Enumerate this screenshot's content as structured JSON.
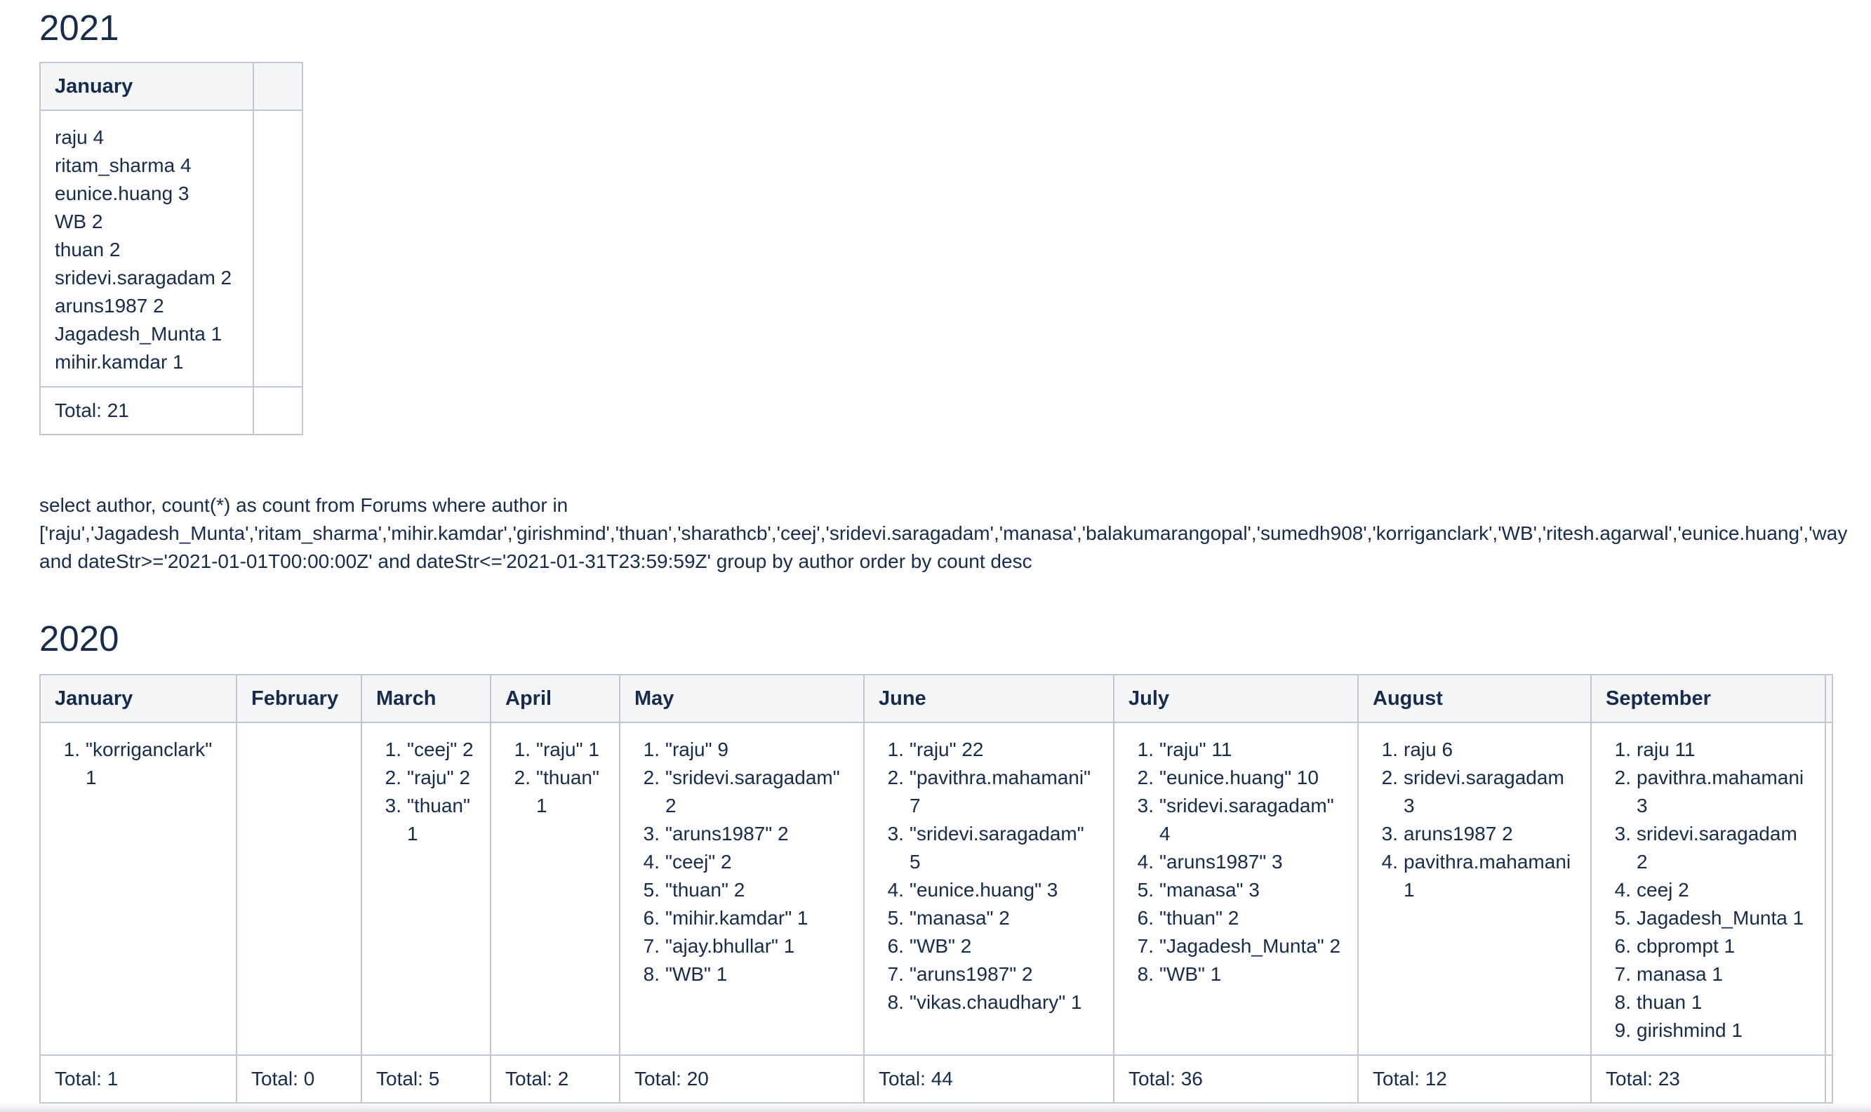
{
  "section_2021": {
    "year": "2021",
    "header": [
      "January",
      ""
    ],
    "entries": [
      "raju 4",
      "ritam_sharma 4",
      "eunice.huang 3",
      "WB 2",
      "thuan 2",
      "sridevi.saragadam 2",
      "aruns1987 2",
      "Jagadesh_Munta 1",
      "mihir.kamdar 1"
    ],
    "total": "Total: 21"
  },
  "query": {
    "line1": "select author, count(*) as count from Forums where author in",
    "line2": "['raju','Jagadesh_Munta','ritam_sharma','mihir.kamdar','girishmind','thuan','sharathcb','ceej','sridevi.saragadam','manasa','balakumarangopal','sumedh908','korriganclark','WB','ritesh.agarwal','eunice.huang','way",
    "line3": "and dateStr>='2021-01-01T00:00:00Z' and dateStr<='2021-01-31T23:59:59Z' group by author order by count desc"
  },
  "section_2020": {
    "year": "2020",
    "months": [
      {
        "name": "January",
        "items": [
          "\"korriganclark\" 1"
        ],
        "total": "Total: 1"
      },
      {
        "name": "February",
        "items": [],
        "total": "Total: 0"
      },
      {
        "name": "March",
        "items": [
          "\"ceej\" 2",
          "\"raju\" 2",
          "\"thuan\" 1"
        ],
        "total": "Total: 5"
      },
      {
        "name": "April",
        "items": [
          "\"raju\" 1",
          "\"thuan\" 1"
        ],
        "total": "Total: 2"
      },
      {
        "name": "May",
        "items": [
          "\"raju\" 9",
          "\"sridevi.saragadam\" 2",
          "\"aruns1987\" 2",
          "\"ceej\" 2",
          "\"thuan\" 2",
          "\"mihir.kamdar\" 1",
          "\"ajay.bhullar\" 1",
          "\"WB\" 1"
        ],
        "total": "Total: 20"
      },
      {
        "name": "June",
        "items": [
          "\"raju\" 22",
          "\"pavithra.mahamani\" 7",
          "\"sridevi.saragadam\" 5",
          "\"eunice.huang\" 3",
          "\"manasa\" 2",
          "\"WB\" 2",
          "\"aruns1987\" 2",
          "\"vikas.chaudhary\" 1"
        ],
        "total": "Total: 44"
      },
      {
        "name": "July",
        "items": [
          "\"raju\" 11",
          "\"eunice.huang\" 10",
          "\"sridevi.saragadam\" 4",
          "\"aruns1987\" 3",
          "\"manasa\" 3",
          "\"thuan\" 2",
          "\"Jagadesh_Munta\" 2",
          "\"WB\" 1"
        ],
        "total": "Total: 36"
      },
      {
        "name": "August",
        "items": [
          "raju 6",
          "sridevi.saragadam 3",
          "aruns1987 2",
          "pavithra.mahamani 1"
        ],
        "total": "Total: 12"
      },
      {
        "name": "September",
        "items": [
          "raju 11",
          "pavithra.mahamani 3",
          "sridevi.saragadam 2",
          "ceej 2",
          "Jagadesh_Munta 1",
          "cbprompt 1",
          "manasa 1",
          "thuan 1",
          "girishmind 1"
        ],
        "total": "Total: 23"
      },
      {
        "name": "",
        "items": [],
        "total": ""
      }
    ]
  }
}
